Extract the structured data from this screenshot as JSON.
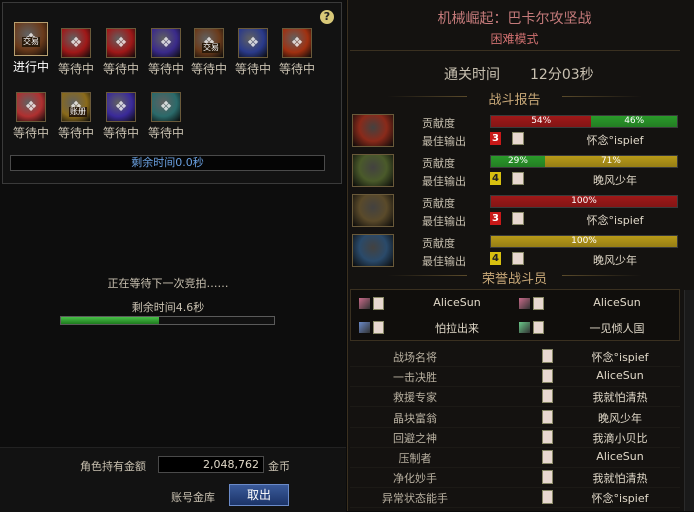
{
  "bid_panel": {
    "help_label": "?",
    "slots": [
      {
        "status": "进行中",
        "tag": "交易",
        "color": "#6a3a1a",
        "active": true
      },
      {
        "status": "等待中",
        "tag": "",
        "color": "#a01818",
        "active": false
      },
      {
        "status": "等待中",
        "tag": "",
        "color": "#a01818",
        "active": false
      },
      {
        "status": "等待中",
        "tag": "",
        "color": "#3a2a8a",
        "active": false
      },
      {
        "status": "等待中",
        "tag": "交易",
        "color": "#6a3a1a",
        "active": false
      },
      {
        "status": "等待中",
        "tag": "",
        "color": "#2a3a8a",
        "active": false
      },
      {
        "status": "等待中",
        "tag": "",
        "color": "#a03010",
        "active": false
      },
      {
        "status": "等待中",
        "tag": "",
        "color": "#b03030",
        "active": false
      },
      {
        "status": "等待中",
        "tag": "账册",
        "color": "#8a6a1a",
        "active": false
      },
      {
        "status": "等待中",
        "tag": "",
        "color": "#3a2a9a",
        "active": false
      },
      {
        "status": "等待中",
        "tag": "",
        "color": "#2a6a6a",
        "active": false
      }
    ],
    "remaining_time": "剩余时间0.0秒"
  },
  "waiting": {
    "message": "正在等待下一次竞拍……",
    "remaining": "剩余时间4.6秒",
    "progress": 0.46
  },
  "gold": {
    "label": "角色持有金额",
    "amount": "2,048,762",
    "unit": "金币",
    "vault_label": "账号金库",
    "withdraw_label": "取出"
  },
  "result": {
    "title": "机械崛起：巴卡尔攻坚战",
    "mode": "困难模式",
    "clear_label": "通关时间",
    "clear_time": "12分03秒",
    "report_title": "战斗报告",
    "contrib_label": "贡献度",
    "best_label": "最佳输出",
    "parties": [
      {
        "avatar_color": "#8a2a1a",
        "segments": [
          {
            "pct": 54,
            "label": "54%",
            "color": "#a01818"
          },
          {
            "pct": 46,
            "label": "46%",
            "color": "#2a9a2a"
          }
        ],
        "rank": "3",
        "rank_color": "#c81818",
        "player": "怀念°ispief"
      },
      {
        "avatar_color": "#4a5a2a",
        "segments": [
          {
            "pct": 29,
            "label": "29%",
            "color": "#2a9a2a"
          },
          {
            "pct": 71,
            "label": "71%",
            "color": "#b89a18"
          }
        ],
        "rank": "4",
        "rank_color": "#d8c010",
        "player": "晚风少年"
      },
      {
        "avatar_color": "#5a4a2a",
        "segments": [
          {
            "pct": 100,
            "label": "100%",
            "color": "#a01818"
          }
        ],
        "rank": "3",
        "rank_color": "#c81818",
        "player": "怀念°ispief"
      },
      {
        "avatar_color": "#2a4a6a",
        "segments": [
          {
            "pct": 100,
            "label": "100%",
            "color": "#b89a18"
          }
        ],
        "rank": "4",
        "rank_color": "#d8c010",
        "player": "晚风少年"
      }
    ],
    "honor_title": "荣誉战斗员",
    "honor": [
      {
        "name": "AliceSun"
      },
      {
        "name": "AliceSun"
      },
      {
        "name": "怕拉出来"
      },
      {
        "name": "一见倾人国"
      }
    ],
    "titles": [
      {
        "title": "战场名将",
        "player": "怀念°ispief"
      },
      {
        "title": "一击决胜",
        "player": "AliceSun"
      },
      {
        "title": "救援专家",
        "player": "我就怕清热"
      },
      {
        "title": "晶块富翁",
        "player": "晚风少年"
      },
      {
        "title": "回避之神",
        "player": "我滴小贝比"
      },
      {
        "title": "压制者",
        "player": "AliceSun"
      },
      {
        "title": "净化妙手",
        "player": "我就怕清热"
      },
      {
        "title": "异常状态能手",
        "player": "怀念°ispief"
      }
    ]
  }
}
